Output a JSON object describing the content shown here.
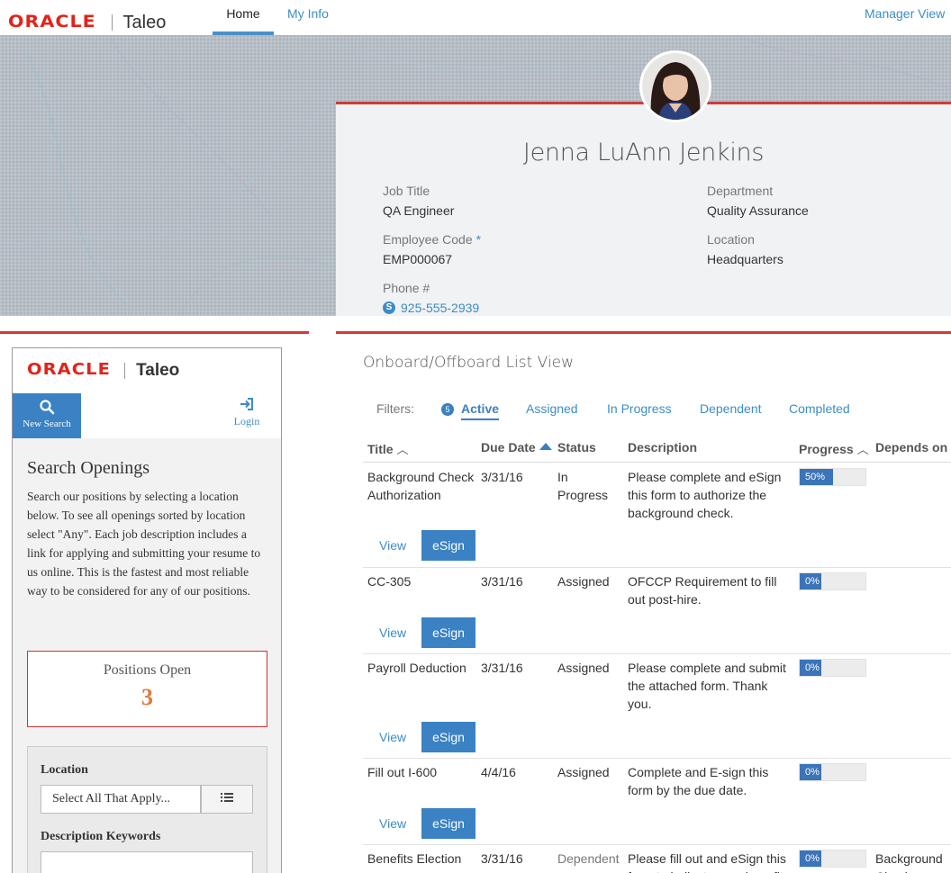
{
  "header": {
    "brand_oracle": "ORACLE",
    "brand_taleo": "Taleo",
    "tabs": [
      {
        "label": "Home",
        "active": true
      },
      {
        "label": "My Info",
        "active": false
      }
    ],
    "manager_view": "Manager View"
  },
  "profile": {
    "name": "Jenna LuAnn Jenkins",
    "job_title_label": "Job Title",
    "job_title": "QA Engineer",
    "department_label": "Department",
    "department": "Quality Assurance",
    "employee_code_label": "Employee Code",
    "employee_code_marker": "*",
    "employee_code": "EMP000067",
    "location_label": "Location",
    "location": "Headquarters",
    "phone_label": "Phone #",
    "phone": "925-555-2939"
  },
  "career_widget": {
    "brand_oracle": "ORACLE",
    "brand_taleo": "Taleo",
    "new_search": "New Search",
    "login": "Login",
    "title": "Search Openings",
    "description": "Search our positions by selecting a location below. To see all openings sorted by location select \"Any\". Each job description includes a link for applying and submitting your resume to us online. This is the fastest and most reliable way to be considered for any of our positions.",
    "positions_open_label": "Positions Open",
    "positions_open_count": "3",
    "location_label": "Location",
    "location_select": "Select All That Apply...",
    "keywords_label": "Description Keywords",
    "keywords_value": ""
  },
  "list_view": {
    "title": "Onboard/Offboard List View",
    "filters_label": "Filters:",
    "active_count": "5",
    "filters": [
      "Active",
      "Assigned",
      "In Progress",
      "Dependent",
      "Completed"
    ],
    "columns": [
      "Title",
      "Due Date",
      "Status",
      "Description",
      "Progress",
      "Depends on"
    ],
    "view_label": "View",
    "esign_label": "eSign",
    "rows": [
      {
        "title": "Background Check Authorization",
        "due": "3/31/16",
        "status": "In Progress",
        "description": "Please complete and eSign this form to authorize the background check.",
        "progress_label": "50%",
        "progress": 0.5,
        "depends": ""
      },
      {
        "title": "CC-305",
        "due": "3/31/16",
        "status": "Assigned",
        "description": "OFCCP Requirement to fill out post-hire.",
        "progress_label": "0%",
        "progress": 0,
        "depends": ""
      },
      {
        "title": "Payroll Deduction",
        "due": "3/31/16",
        "status": "Assigned",
        "description": "Please complete and submit the attached form. Thank you.",
        "progress_label": "0%",
        "progress": 0,
        "depends": ""
      },
      {
        "title": "Fill out I-600",
        "due": "4/4/16",
        "status": "Assigned",
        "description": "Complete and E-sign this form by the due date.",
        "progress_label": "0%",
        "progress": 0,
        "depends": ""
      },
      {
        "title": "Benefits Election",
        "due": "3/31/16",
        "status": "Dependent",
        "description": "Please fill out and eSign this form to indicate your benefits selections.",
        "progress_label": "0%",
        "progress": 0,
        "depends": "Background Check"
      }
    ]
  }
}
